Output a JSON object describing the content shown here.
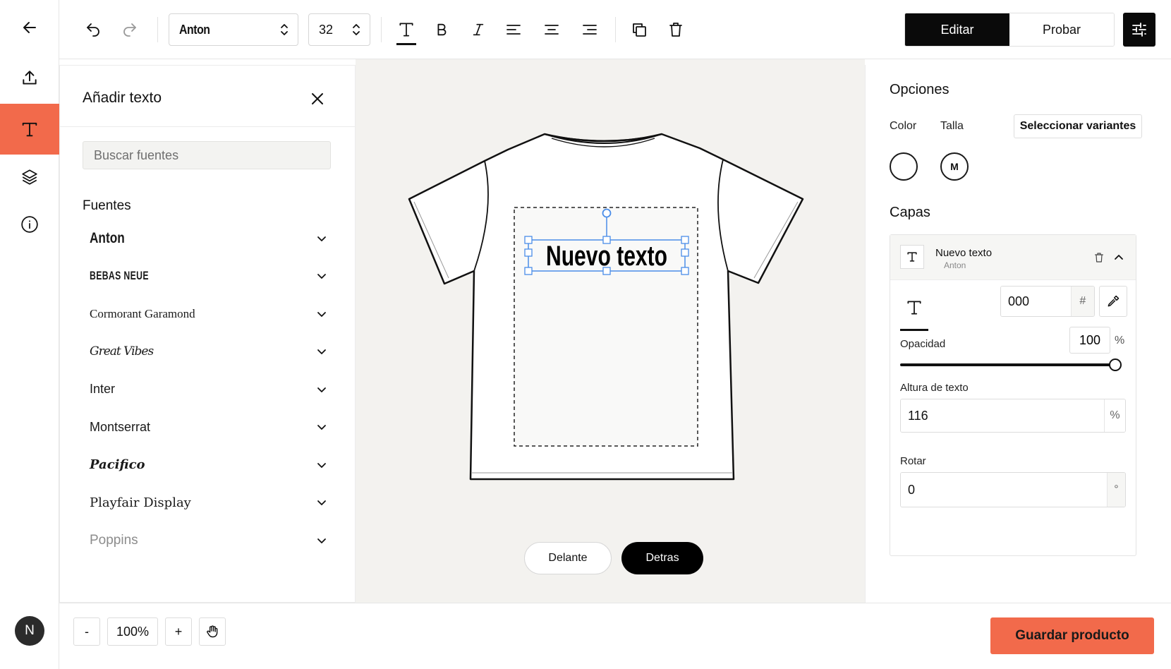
{
  "rail": {
    "items": [
      {
        "icon": "back-arrow-icon"
      },
      {
        "icon": "upload-icon"
      },
      {
        "icon": "text-tool-icon",
        "active": true
      },
      {
        "icon": "layers-icon"
      },
      {
        "icon": "info-icon"
      }
    ],
    "avatar_initial": "N"
  },
  "toolbar": {
    "font_value": "Anton",
    "size_value": "32",
    "mode_edit": "Editar",
    "mode_try": "Probar"
  },
  "left_panel": {
    "title": "Añadir texto",
    "search_placeholder": "Buscar fuentes",
    "section": "Fuentes",
    "fonts": [
      {
        "name": "Anton",
        "style": "anton"
      },
      {
        "name": "Bebas Neue",
        "style": "bebas"
      },
      {
        "name": "Cormorant Garamond",
        "style": "garamond"
      },
      {
        "name": "Great Vibes",
        "style": "great"
      },
      {
        "name": "Inter",
        "style": "inter"
      },
      {
        "name": "Montserrat",
        "style": "montserrat"
      },
      {
        "name": "Pacifico",
        "style": "pacifico"
      },
      {
        "name": "Playfair Display",
        "style": "playfair"
      },
      {
        "name": "Poppins",
        "style": "poppins"
      }
    ]
  },
  "canvas": {
    "text_on_shirt": "Nuevo texto",
    "front_label": "Delante",
    "back_label": "Detras",
    "active_side": "back"
  },
  "right_panel": {
    "title": "Opciones",
    "color_label": "Color",
    "size_label": "Talla",
    "variants_button": "Seleccionar variantes",
    "size_value": "M",
    "layers_title": "Capas",
    "layer": {
      "name": "Nuevo texto",
      "font": "Anton",
      "color_hex": "000",
      "hash": "#",
      "opacity_label": "Opacidad",
      "opacity_value": "100",
      "opacity_fraction": 1.0,
      "percent": "%",
      "height_label": "Altura de texto",
      "height_value": "116",
      "rotate_label": "Rotar",
      "rotate_value": "0",
      "degree": "°"
    }
  },
  "bottom": {
    "zoom_minus": "-",
    "zoom_value": "100%",
    "zoom_plus": "+",
    "save_label": "Guardar producto"
  },
  "colors": {
    "accent": "#f26a4b",
    "dark": "#0a0a0a",
    "selection": "#4a8de8"
  }
}
